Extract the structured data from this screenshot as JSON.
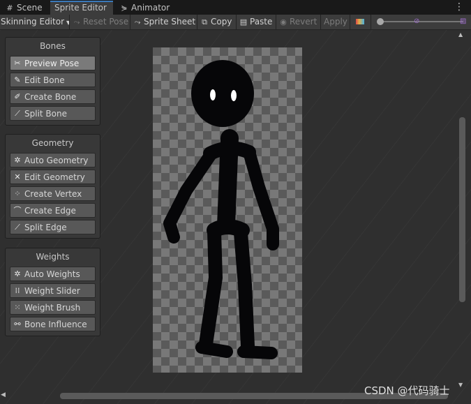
{
  "tabs": [
    {
      "label": "Scene",
      "icon": "grid-icon",
      "active": false
    },
    {
      "label": "Sprite Editor",
      "icon": "",
      "active": true
    },
    {
      "label": "Animator",
      "icon": "animator-icon",
      "active": false
    }
  ],
  "toolbar": {
    "mode_label": "Skinning Editor",
    "reset_pose": "Reset Pose",
    "sprite_sheet": "Sprite Sheet",
    "copy": "Copy",
    "paste": "Paste",
    "revert": "Revert",
    "apply": "Apply"
  },
  "panels": {
    "bones": {
      "title": "Bones",
      "tools": [
        {
          "label": "Preview Pose",
          "icon": "preview-pose-icon",
          "active": true
        },
        {
          "label": "Edit Bone",
          "icon": "edit-bone-icon",
          "active": false
        },
        {
          "label": "Create Bone",
          "icon": "create-bone-icon",
          "active": false
        },
        {
          "label": "Split Bone",
          "icon": "split-bone-icon",
          "active": false
        }
      ]
    },
    "geometry": {
      "title": "Geometry",
      "tools": [
        {
          "label": "Auto Geometry",
          "icon": "auto-geometry-icon",
          "active": false
        },
        {
          "label": "Edit Geometry",
          "icon": "edit-geometry-icon",
          "active": false
        },
        {
          "label": "Create Vertex",
          "icon": "create-vertex-icon",
          "active": false
        },
        {
          "label": "Create Edge",
          "icon": "create-edge-icon",
          "active": false
        },
        {
          "label": "Split Edge",
          "icon": "split-edge-icon",
          "active": false
        }
      ]
    },
    "weights": {
      "title": "Weights",
      "tools": [
        {
          "label": "Auto Weights",
          "icon": "auto-weights-icon",
          "active": false
        },
        {
          "label": "Weight Slider",
          "icon": "weight-slider-icon",
          "active": false
        },
        {
          "label": "Weight Brush",
          "icon": "weight-brush-icon",
          "active": false
        },
        {
          "label": "Bone Influence",
          "icon": "bone-influence-icon",
          "active": false
        }
      ]
    }
  },
  "watermark": "CSDN @代码骑士",
  "colors": {
    "sprite": "#060608",
    "eyes": "#ffffff",
    "active_tab_accent": "#3a79bb"
  }
}
